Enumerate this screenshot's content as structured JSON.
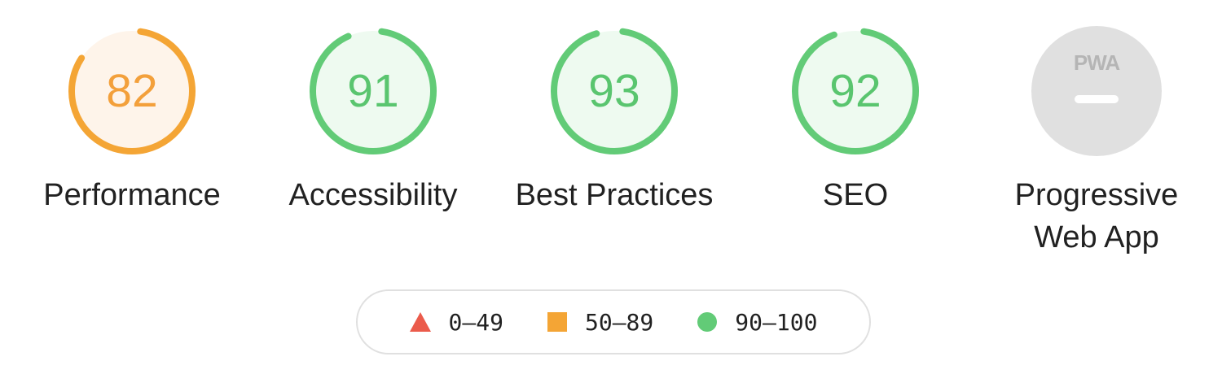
{
  "gauges": [
    {
      "id": "performance",
      "label": "Performance",
      "score": "82",
      "value": 82,
      "rating": "average"
    },
    {
      "id": "accessibility",
      "label": "Accessibility",
      "score": "91",
      "value": 91,
      "rating": "pass"
    },
    {
      "id": "best-practices",
      "label": "Best Practices",
      "score": "93",
      "value": 93,
      "rating": "pass"
    },
    {
      "id": "seo",
      "label": "SEO",
      "score": "92",
      "value": 92,
      "rating": "pass"
    },
    {
      "id": "pwa",
      "label": "Progressive\nWeb App",
      "badge": "PWA",
      "rating": "na"
    }
  ],
  "legend": [
    {
      "shape": "triangle",
      "text": "0–49",
      "color": "#eb5b4b"
    },
    {
      "shape": "square",
      "text": "50–89",
      "color": "#f4a535"
    },
    {
      "shape": "circle",
      "text": "90–100",
      "color": "#62cb77"
    }
  ],
  "colors": {
    "pass": {
      "stroke": "#62cb77",
      "fill": "#eefaf0",
      "text": "#5ac56f"
    },
    "average": {
      "stroke": "#f4a535",
      "fill": "#fef4ea",
      "text": "#f3a03b"
    },
    "na": {
      "fill": "#e0e0e0",
      "mark": "#ffffff",
      "text": "#b5b5b5"
    }
  }
}
